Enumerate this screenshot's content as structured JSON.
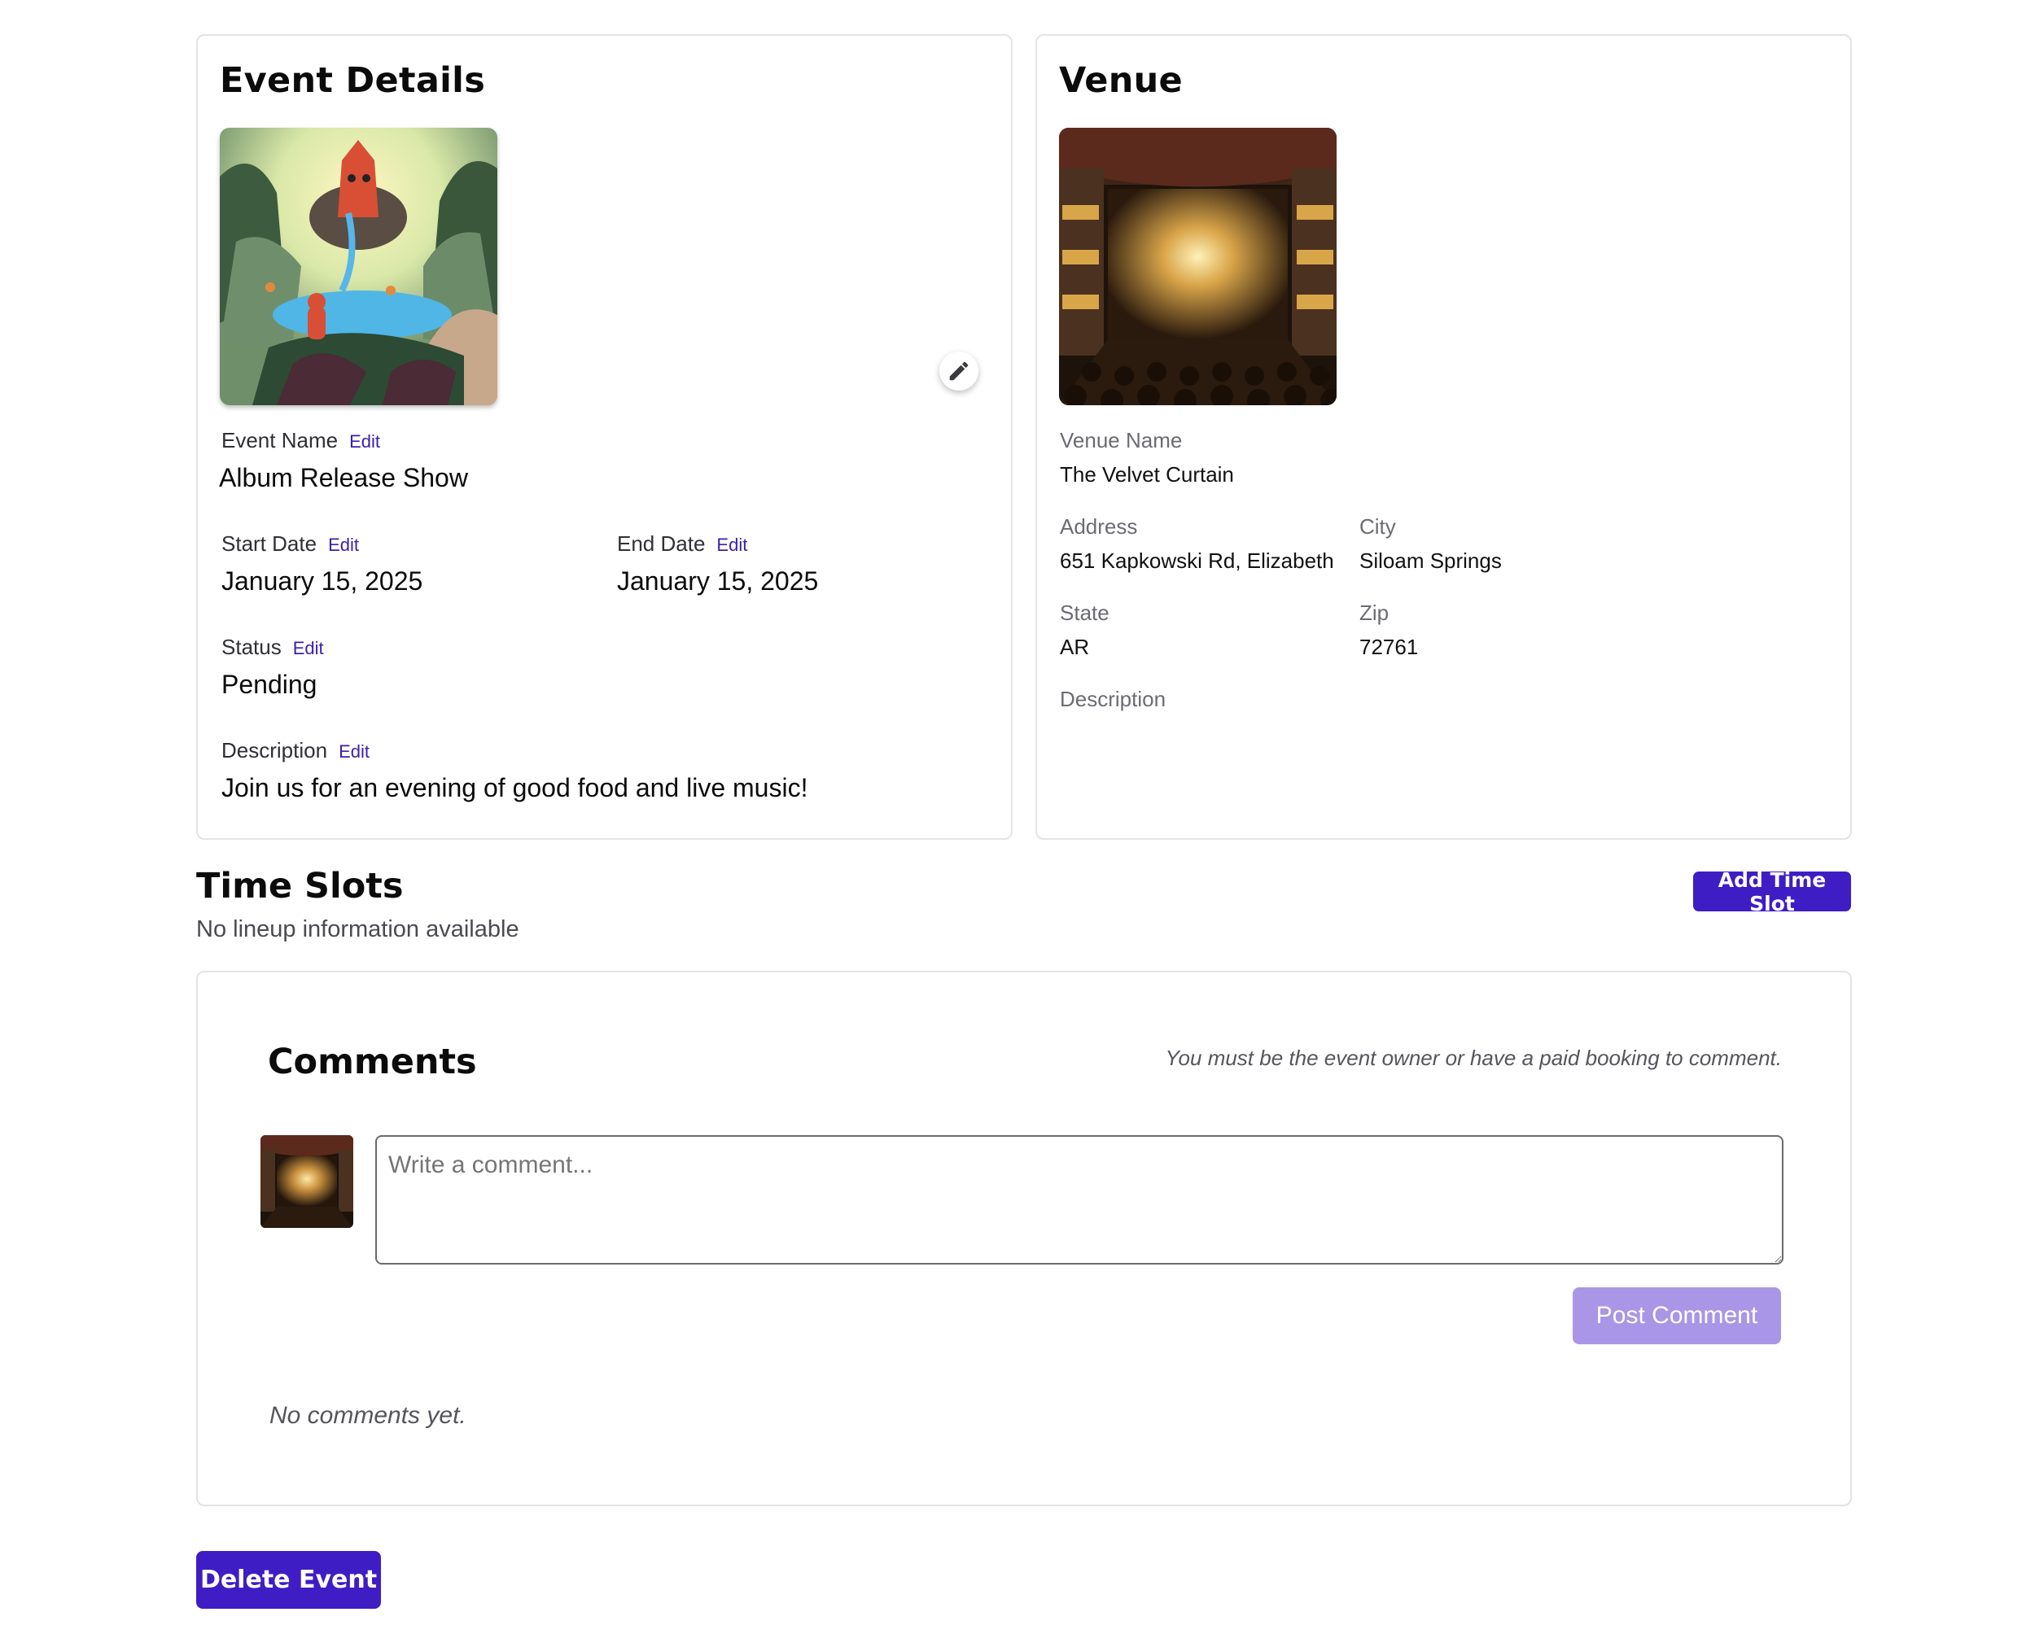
{
  "event": {
    "title": "Event Details",
    "name_label": "Event Name",
    "name_value": "Album Release Show",
    "start_label": "Start Date",
    "start_value": "January 15, 2025",
    "end_label": "End Date",
    "end_value": "January 15, 2025",
    "status_label": "Status",
    "status_value": "Pending",
    "description_label": "Description",
    "description_value": "Join us for an evening of good food and live music!",
    "edit_label": "Edit",
    "image_icon": "event-artwork-image",
    "edit_image_icon": "pencil-icon"
  },
  "venue": {
    "title": "Venue",
    "image_icon": "theater-stage-image",
    "name_label": "Venue Name",
    "name_value": "The Velvet Curtain",
    "address_label": "Address",
    "address_value": "651 Kapkowski Rd, Elizabeth",
    "city_label": "City",
    "city_value": "Siloam Springs",
    "state_label": "State",
    "state_value": "AR",
    "zip_label": "Zip",
    "zip_value": "72761",
    "description_label": "Description"
  },
  "time_slots": {
    "title": "Time Slots",
    "empty_text": "No lineup information available",
    "add_button": "Add Time Slot"
  },
  "comments": {
    "title": "Comments",
    "permission_note": "You must be the event owner or have a paid booking to comment.",
    "input_placeholder": "Write a comment...",
    "post_button": "Post Comment",
    "empty_text": "No comments yet."
  },
  "actions": {
    "delete_button": "Delete Event"
  },
  "colors": {
    "accent": "#3f1dc4",
    "accent_disabled": "#a996e6",
    "edit_link": "#3b1fa8",
    "card_border": "#e4e4e7"
  }
}
